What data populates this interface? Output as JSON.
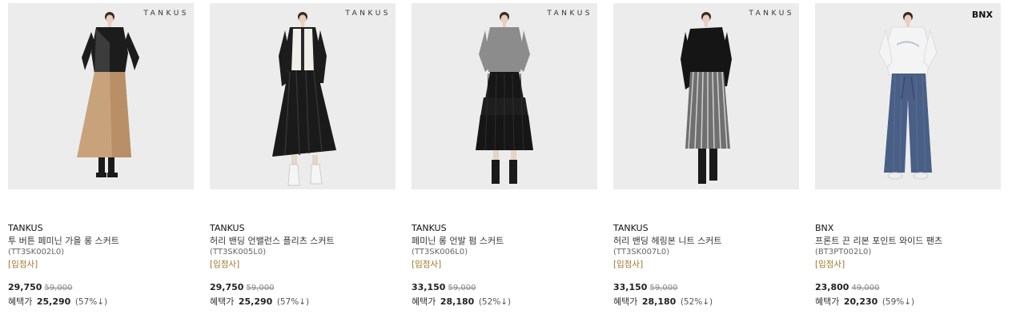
{
  "products": [
    {
      "logo": "TANKUS",
      "brand": "TANKUS",
      "name": "투 버튼 페미닌 가을 롱 스커트",
      "code": "(TT3SK002L0)",
      "tag": "[입점사]",
      "price": "29,750",
      "original_price": "59,000",
      "benefit_label": "혜택가",
      "benefit_price": "25,290",
      "benefit_pct": "(57%↓)",
      "top_color": "#1c1c1c",
      "bottom_color": "#c8a27a",
      "bottom_type": "wrap-skirt",
      "shoe_color": "#1a1a1a"
    },
    {
      "logo": "TANKUS",
      "brand": "TANKUS",
      "name": "허리 밴딩 언밸런스 플리츠 스커트",
      "code": "(TT3SK005L0)",
      "tag": "[입점사]",
      "price": "29,750",
      "original_price": "59,000",
      "benefit_label": "혜택가",
      "benefit_price": "25,290",
      "benefit_pct": "(57%↓)",
      "top_color": "#f1efe9",
      "bottom_color": "#1a1a1a",
      "bottom_type": "pleated-skirt",
      "shoe_color": "#f5f5f5"
    },
    {
      "logo": "TANKUS",
      "brand": "TANKUS",
      "name": "페미닌 롱 언발 펌 스커트",
      "code": "(TT3SK006L0)",
      "tag": "[입점사]",
      "price": "33,150",
      "original_price": "59,000",
      "benefit_label": "혜택가",
      "benefit_price": "28,180",
      "benefit_pct": "(52%↓)",
      "top_color": "#8c8c8c",
      "bottom_color": "#161616",
      "bottom_type": "tiered-skirt",
      "shoe_color": "#1a1a1a"
    },
    {
      "logo": "TANKUS",
      "brand": "TANKUS",
      "name": "허리 밴딩 헤링본 니트 스커트",
      "code": "(TT3SK007L0)",
      "tag": "[입점사]",
      "price": "33,150",
      "original_price": "59,000",
      "benefit_label": "혜택가",
      "benefit_price": "28,180",
      "benefit_pct": "(52%↓)",
      "top_color": "#151515",
      "bottom_color": "#6f6f6f",
      "bottom_type": "striped-skirt",
      "shoe_color": "#1a1a1a"
    },
    {
      "logo": "BNX",
      "brand": "BNX",
      "name": "프론트 끈 리본 포인트 와이드 팬츠",
      "code": "(BT3PT002L0)",
      "tag": "[입점사]",
      "price": "23,800",
      "original_price": "49,000",
      "benefit_label": "혜택가",
      "benefit_price": "20,230",
      "benefit_pct": "(59%↓)",
      "top_color": "#f4f4f4",
      "bottom_color": "#4a5f86",
      "bottom_type": "wide-pants",
      "shoe_color": "#eeeeee"
    }
  ]
}
